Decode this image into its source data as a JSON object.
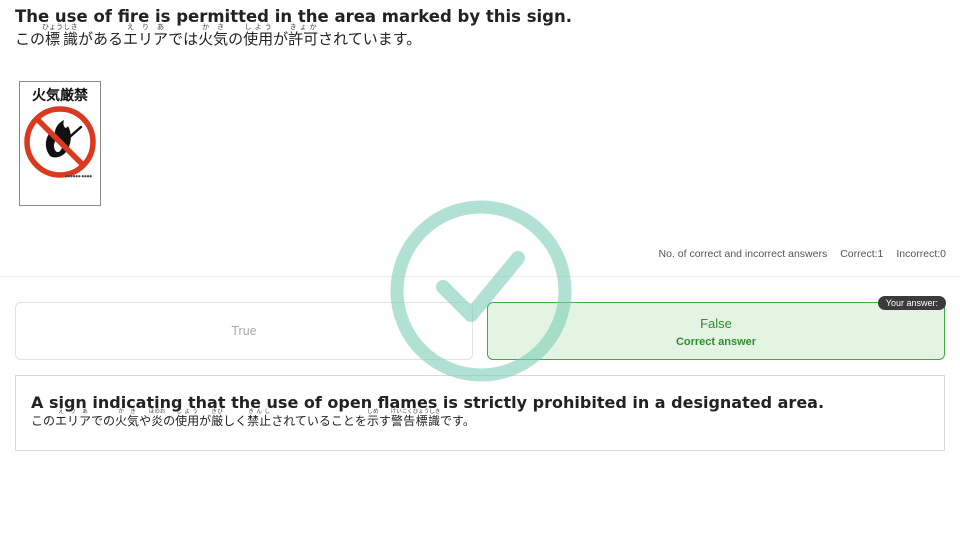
{
  "question": {
    "english": "The use of fire is permitted in the area marked by this sign.",
    "japanese_base": [
      "この",
      "標",
      "識",
      "がある",
      "エリア",
      "では",
      "火気",
      "の",
      "使用",
      "が",
      "許可",
      "されています。"
    ],
    "japanese_ruby": [
      "",
      "ひょう",
      "しき",
      "",
      "えりあ",
      "",
      "かき",
      "",
      "しよう",
      "",
      "きょか",
      ""
    ]
  },
  "sign": {
    "title": "火気厳禁",
    "icon": "no-open-flame-icon",
    "colors": {
      "prohibition": "#d9391f",
      "symbol": "#111111"
    }
  },
  "stats": {
    "label": "No. of correct and incorrect answers",
    "correct": "Correct:1",
    "incorrect": "Incorrect:0"
  },
  "options": {
    "true_label": "True",
    "false_label": "False",
    "correct_answer_label": "Correct answer",
    "your_answer_badge": "Your answer:",
    "selected": "False",
    "correct": "False"
  },
  "explanation": {
    "english": "A sign indicating that the use of open flames is strictly prohibited in a designated area.",
    "japanese_base": [
      "この",
      "エリア",
      "での",
      "火気",
      "や",
      "炎",
      "の",
      "使用",
      "が",
      "厳",
      "しく",
      "禁止",
      "されていることを",
      "示",
      "す",
      "警告標識",
      "です。"
    ],
    "japanese_ruby": [
      "",
      "えりあ",
      "",
      "かき",
      "",
      "ほのお",
      "",
      "しよう",
      "",
      "きび",
      "",
      "きんし",
      "",
      "しめ",
      "",
      "けいこくひょうしき",
      ""
    ]
  },
  "result": {
    "icon": "check-circle-icon",
    "color": "#8fd3c0"
  },
  "colors": {
    "correct_green": "#2f8c2f",
    "correct_bg": "#e4f4e3",
    "badge_bg": "#3b3b3b"
  }
}
